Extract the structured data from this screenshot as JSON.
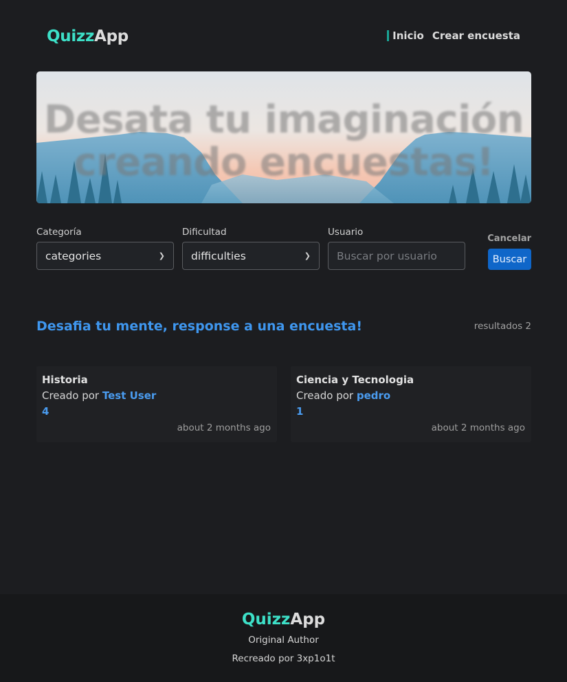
{
  "header": {
    "logo_part1": "Quizz",
    "logo_part2": "App",
    "nav": {
      "home": "Inicio",
      "create": "Crear encuesta"
    }
  },
  "hero": {
    "line1": "Desata tu imaginación",
    "line2": "creando encuestas!"
  },
  "filters": {
    "category": {
      "label": "Categoría",
      "value": "categories"
    },
    "difficulty": {
      "label": "Dificultad",
      "value": "difficulties"
    },
    "user": {
      "label": "Usuario",
      "placeholder": "Buscar por usuario"
    },
    "cancel": "Cancelar",
    "search": "Buscar"
  },
  "main": {
    "title": "Desafia tu mente, response a una encuesta!",
    "results": "resultados 2"
  },
  "cards": [
    {
      "title": "Historia",
      "created_by": "Creado por",
      "user": "Test User",
      "count": "4",
      "time": "about 2 months ago"
    },
    {
      "title": "Ciencia y Tecnologia",
      "created_by": "Creado por",
      "user": "pedro",
      "count": "1",
      "time": "about 2 months ago"
    }
  ],
  "footer": {
    "logo_part1": "Quizz",
    "logo_part2": "App",
    "line1": "Original Author",
    "line2": "Recreado por 3xp1o1t"
  },
  "colors": {
    "accent": "#3de0c8",
    "link": "#4a9cf0",
    "button": "#0f66c9",
    "background": "#1c1d20"
  }
}
